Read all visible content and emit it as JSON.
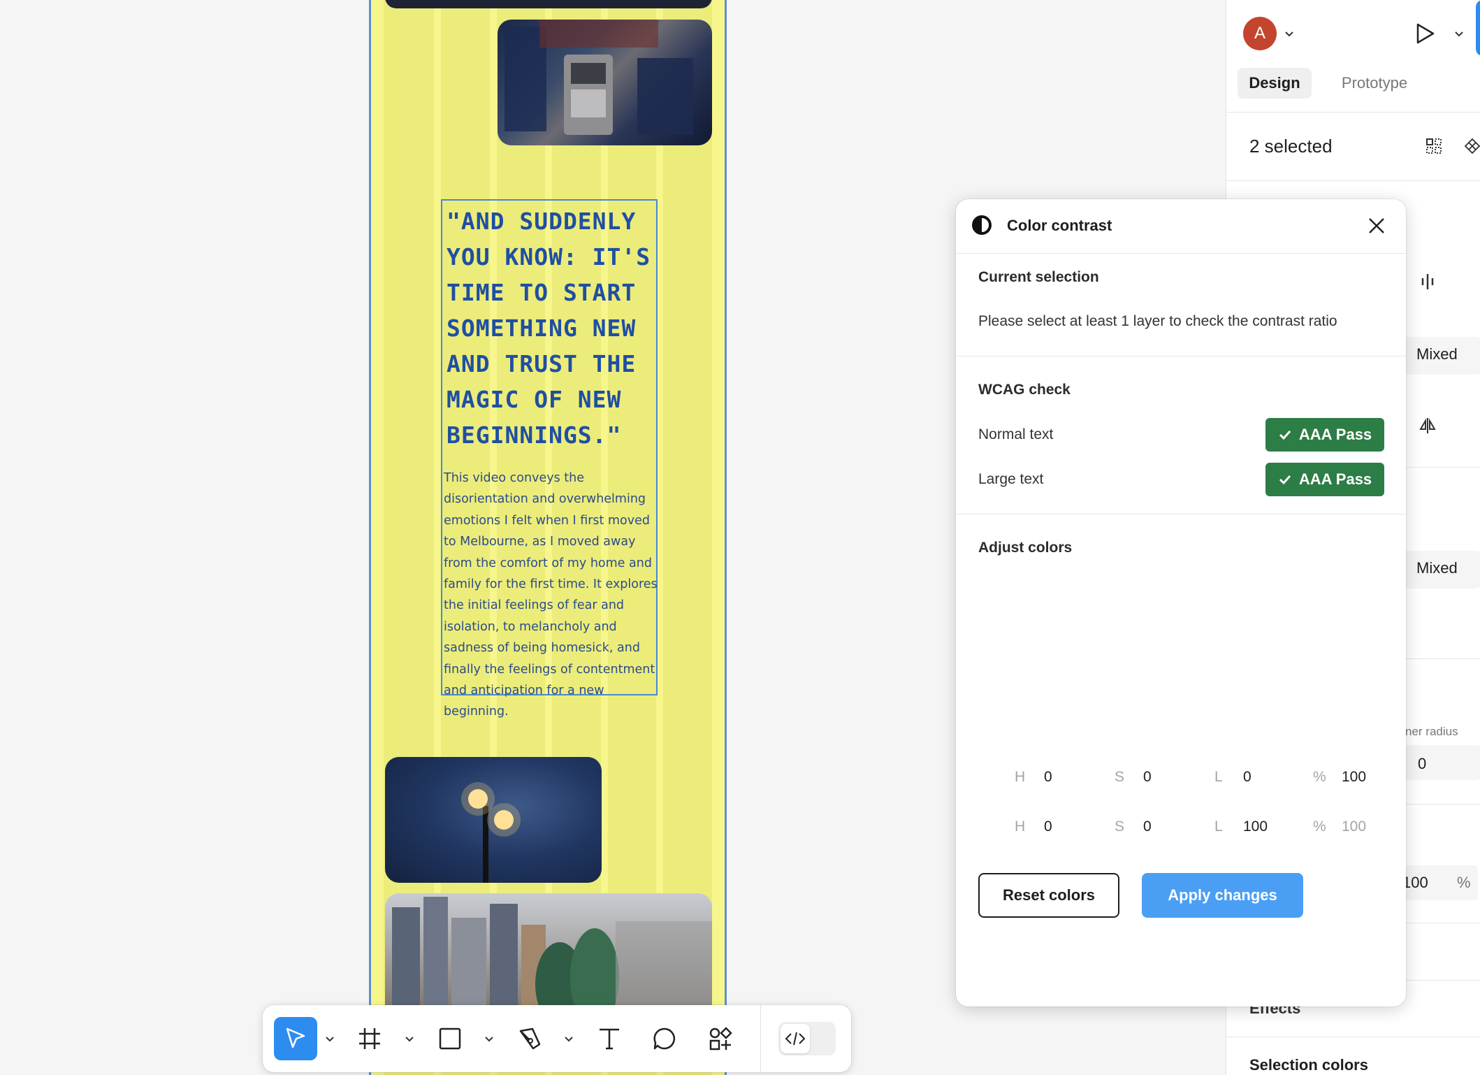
{
  "canvas": {
    "quote_title": "\"AND SUDDENLY YOU KNOW: IT'S TIME TO START SOMETHING NEW AND TRUST THE MAGIC OF NEW BEGINNINGS.\"",
    "quote_body": "This video conveys the disorientation and overwhelming emotions I felt when I first moved to Melbourne, as I moved away from the comfort of my home and family for the first time. It explores the initial feelings of fear and isolation, to melancholy and sadness of being homesick, and finally the feelings of contentment and anticipation for a new beginning."
  },
  "right_panel": {
    "avatar_initial": "A",
    "tabs": [
      "Design",
      "Prototype"
    ],
    "selection_label": "2 selected",
    "mixed_1": "Mixed",
    "mixed_2": "Mixed",
    "corner_radius_label": "ner radius",
    "corner_radius_value": "0",
    "opacity_value": "100",
    "opacity_unit": "%",
    "effects_label": "Effects",
    "selection_colors_label": "Selection colors"
  },
  "dialog": {
    "title": "Color contrast",
    "current_selection_heading": "Current selection",
    "current_selection_msg": "Please select at least 1 layer to check the contrast ratio",
    "wcag_heading": "WCAG check",
    "normal_text_label": "Normal text",
    "normal_text_result": "AAA Pass",
    "large_text_label": "Large text",
    "large_text_result": "AAA Pass",
    "adjust_heading": "Adjust colors",
    "row1": {
      "h": "0",
      "s": "0",
      "l": "0",
      "a": "100"
    },
    "row2": {
      "h": "0",
      "s": "0",
      "l": "100",
      "a": "100"
    },
    "label_h": "H",
    "label_s": "S",
    "label_l": "L",
    "label_pct": "%",
    "reset_label": "Reset colors",
    "apply_label": "Apply changes",
    "pass_color": "#2d7d46",
    "apply_color": "#4a9ff5"
  },
  "toolbar": {
    "tools": [
      "move-tool",
      "frame-tool",
      "rectangle-tool",
      "pen-tool",
      "text-tool",
      "comment-tool",
      "actions-tool",
      "dev-mode-toggle"
    ]
  }
}
